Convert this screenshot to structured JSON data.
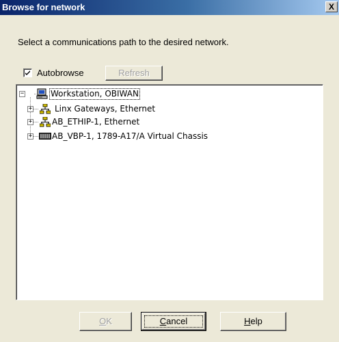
{
  "window": {
    "title": "Browse for network",
    "close_label": "X"
  },
  "instruction": "Select a communications path to the desired network.",
  "autobrowse": {
    "label": "Autobrowse",
    "checked": true
  },
  "refresh_button": {
    "label": "Refresh",
    "enabled": false
  },
  "tree": {
    "root": {
      "label": "Workstation, OBIWAN",
      "icon": "workstation-icon",
      "expanded": true,
      "selected": true
    },
    "children": [
      {
        "label": "Linx Gateways, Ethernet",
        "icon": "ethernet-network-icon",
        "expanded": false
      },
      {
        "label": "AB_ETHIP-1, Ethernet",
        "icon": "ethernet-network-icon",
        "expanded": false
      },
      {
        "label": "AB_VBP-1, 1789-A17/A Virtual Chassis",
        "icon": "virtual-chassis-icon",
        "expanded": false
      }
    ]
  },
  "buttons": {
    "ok": {
      "label_mnemonic": "O",
      "label_rest": "K",
      "enabled": false
    },
    "cancel": {
      "label_mnemonic": "C",
      "label_rest": "ancel",
      "enabled": true,
      "default": true
    },
    "help": {
      "label_mnemonic": "H",
      "label_rest": "elp",
      "enabled": true
    }
  },
  "colors": {
    "titlebar_start": "#0a246a",
    "titlebar_end": "#a6caf0",
    "dialog_bg": "#ece9d8",
    "network_icon": "#d4c000"
  }
}
